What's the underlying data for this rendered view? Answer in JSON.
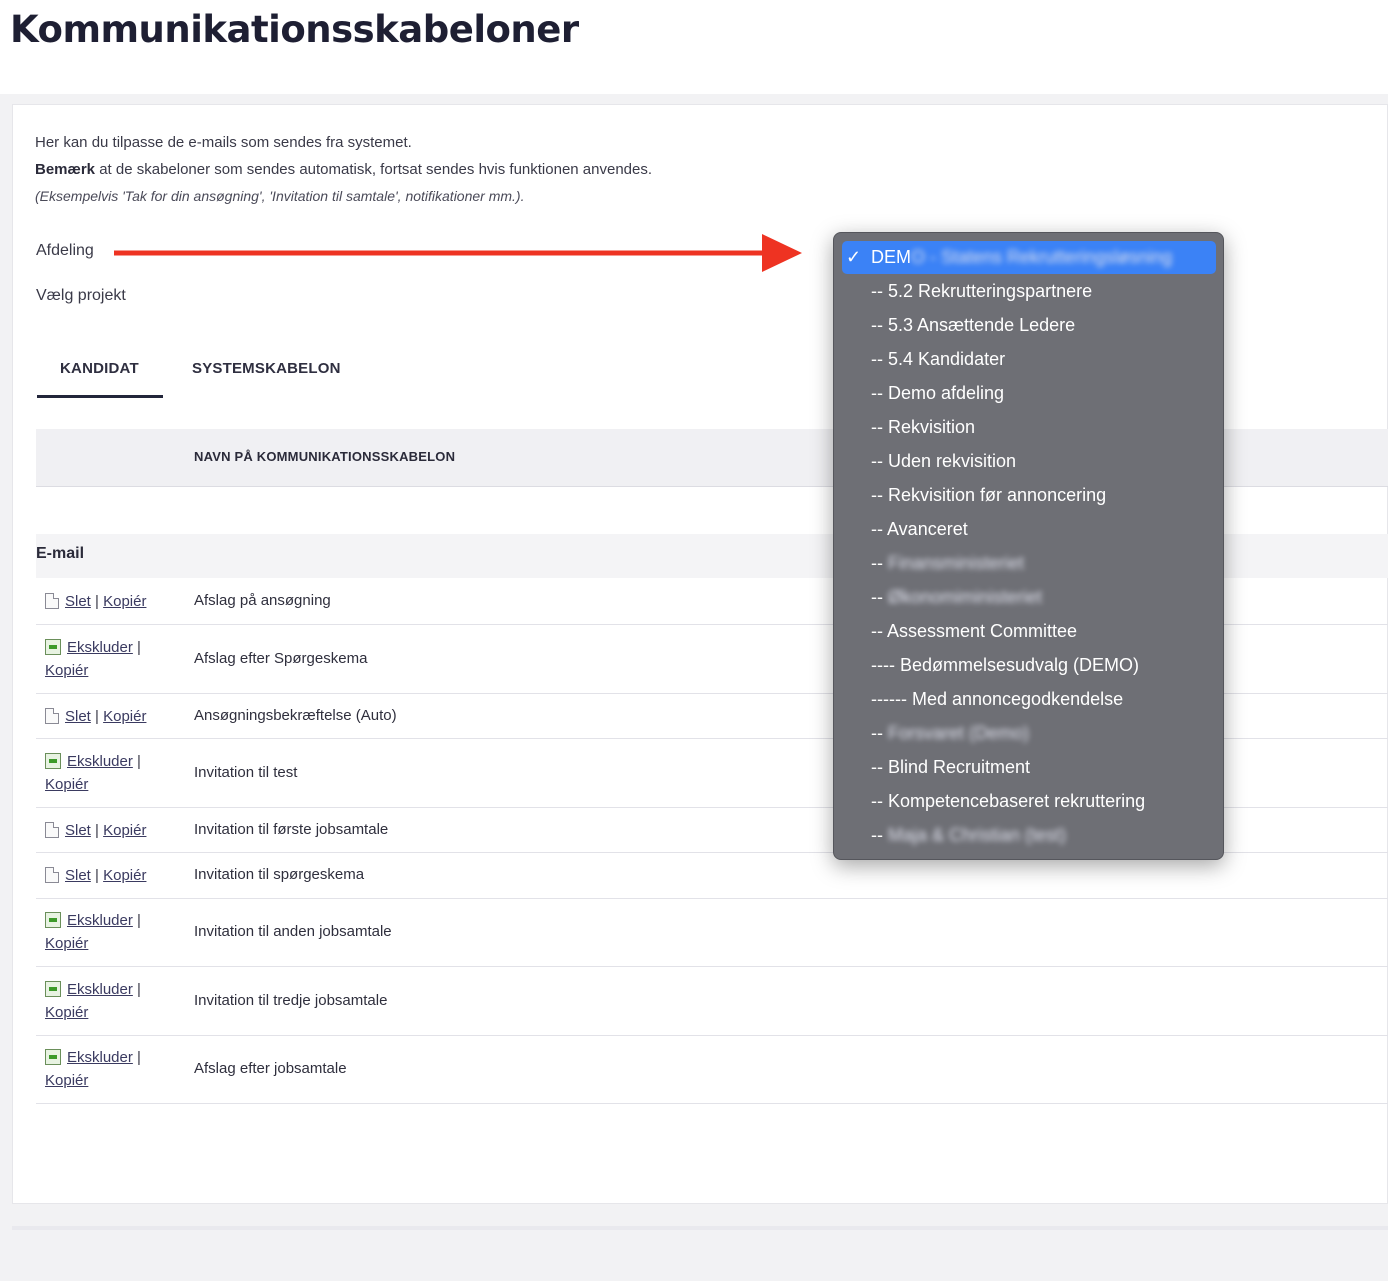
{
  "page": {
    "title": "Kommunikationsskabeloner"
  },
  "intro": {
    "line1": "Her kan du tilpasse de e-mails som sendes fra systemet.",
    "line2_bold": "Bemærk",
    "line2_rest": " at de skabeloner som sendes automatisk, fortsat sendes hvis funktionen anvendes.",
    "line3": "(Eksempelvis 'Tak for din ansøgning', 'Invitation til samtale', notifikationer mm.)."
  },
  "fields": {
    "afdeling_label": "Afdeling",
    "projekt_label": "Vælg projekt"
  },
  "tabs": [
    {
      "label": "KANDIDAT",
      "active": true
    },
    {
      "label": "SYSTEMSKABELON",
      "active": false
    }
  ],
  "table": {
    "header_name": "NAVN PÅ KOMMUNIKATIONSSKABELON",
    "section": "E-mail",
    "rows": [
      {
        "icon": "document-icon",
        "action1": "Slet",
        "action2": "Kopiér",
        "name": "Afslag på ansøgning"
      },
      {
        "icon": "spreadsheet-icon",
        "action1": "Ekskluder",
        "action2": "Kopiér",
        "name": "Afslag efter Spørgeskema"
      },
      {
        "icon": "document-icon",
        "action1": "Slet",
        "action2": "Kopiér",
        "name": "Ansøgningsbekræftelse (Auto)"
      },
      {
        "icon": "spreadsheet-icon",
        "action1": "Ekskluder",
        "action2": "Kopiér",
        "name": "Invitation til test"
      },
      {
        "icon": "document-icon",
        "action1": "Slet",
        "action2": "Kopiér",
        "name": "Invitation til første jobsamtale"
      },
      {
        "icon": "document-icon",
        "action1": "Slet",
        "action2": "Kopiér",
        "name": "Invitation til spørgeskema"
      },
      {
        "icon": "spreadsheet-icon",
        "action1": "Ekskluder",
        "action2": "Kopiér",
        "name": "Invitation til anden jobsamtale"
      },
      {
        "icon": "spreadsheet-icon",
        "action1": "Ekskluder",
        "action2": "Kopiér",
        "name": "Invitation til tredje jobsamtale"
      },
      {
        "icon": "spreadsheet-icon",
        "action1": "Ekskluder",
        "action2": "Kopiér",
        "name": "Afslag efter jobsamtale"
      }
    ]
  },
  "dropdown": {
    "selected_prefix": "DEM",
    "selected_blurred": "O - Statens Rekrutteringsløsning",
    "items": [
      {
        "prefix": "-- ",
        "label": "5.2 Rekrutteringspartnere",
        "blurred": false
      },
      {
        "prefix": "-- ",
        "label": "5.3 Ansættende Ledere",
        "blurred": false
      },
      {
        "prefix": "-- ",
        "label": "5.4 Kandidater",
        "blurred": false
      },
      {
        "prefix": "-- ",
        "label": "Demo afdeling",
        "blurred": false
      },
      {
        "prefix": "-- ",
        "label": "Rekvisition",
        "blurred": false
      },
      {
        "prefix": "-- ",
        "label": "Uden rekvisition",
        "blurred": false
      },
      {
        "prefix": "-- ",
        "label": "Rekvisition før annoncering",
        "blurred": false
      },
      {
        "prefix": "-- ",
        "label": "Avanceret",
        "blurred": false
      },
      {
        "prefix": "-- ",
        "label": "Finansministeriet",
        "blurred": true
      },
      {
        "prefix": "-- ",
        "label": "Økonomiministeriet",
        "blurred": true
      },
      {
        "prefix": "-- ",
        "label": "Assessment Committee",
        "blurred": false
      },
      {
        "prefix": "---- ",
        "label": "Bedømmelsesudvalg (DEMO)",
        "blurred": false
      },
      {
        "prefix": "------ ",
        "label": "Med annoncegodkendelse",
        "blurred": false
      },
      {
        "prefix": "-- ",
        "label": "Forsvaret (Demo)",
        "blurred": true
      },
      {
        "prefix": "-- ",
        "label": "Blind Recruitment",
        "blurred": false
      },
      {
        "prefix": "-- ",
        "label": "Kompetencebaseret rekruttering",
        "blurred": false
      },
      {
        "prefix": "-- ",
        "label": "Maja & Christian (test)",
        "blurred": true
      }
    ]
  },
  "colors": {
    "accent": "#3b82f6",
    "annotation_arrow": "#ee3322",
    "dropdown_bg": "#6e6f75"
  }
}
